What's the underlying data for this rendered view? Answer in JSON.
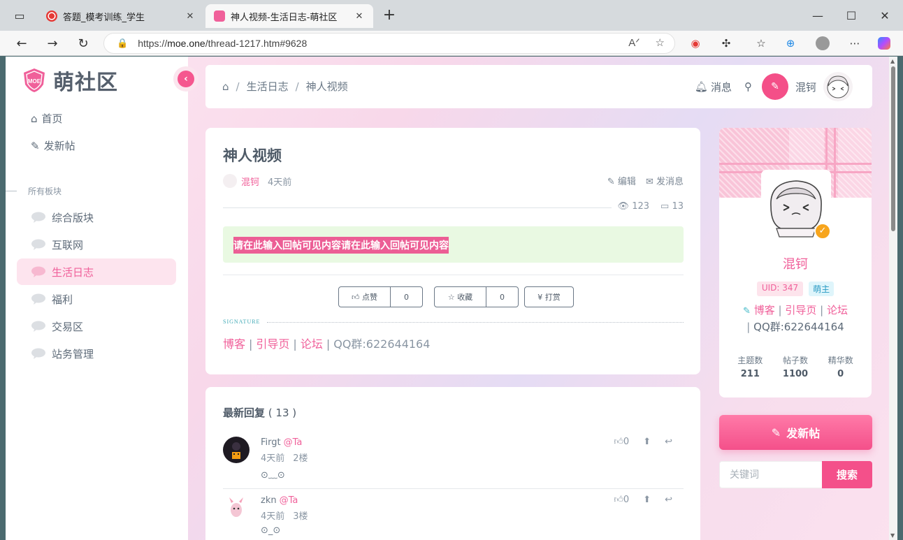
{
  "browser": {
    "tabs": [
      {
        "label": "答题_模考训练_学生"
      },
      {
        "label": "神人视频-生活日志-萌社区"
      }
    ],
    "url_prefix": "https://",
    "url_host": "moe.one",
    "url_path": "/thread-1217.htm#9628"
  },
  "sidebar": {
    "brand": "萌社区",
    "logo_text": "MOE",
    "nav": [
      {
        "label": "首页"
      },
      {
        "label": "发新帖"
      }
    ],
    "section_label": "所有板块",
    "forums": [
      {
        "label": "综合版块"
      },
      {
        "label": "互联网"
      },
      {
        "label": "生活日志"
      },
      {
        "label": "福利"
      },
      {
        "label": "交易区"
      },
      {
        "label": "站务管理"
      }
    ]
  },
  "header": {
    "breadcrumb": [
      "生活日志",
      "神人视频"
    ],
    "messages": "消息",
    "username": "混钶"
  },
  "thread": {
    "title": "神人视频",
    "author": "混钶",
    "time": "4天前",
    "edit": "编辑",
    "send_message": "发消息",
    "views": "123",
    "comments": "13",
    "hidden_text": "请在此输入回帖可见内容请在此输入回帖可见内容",
    "like_label": "点赞",
    "like_count": "0",
    "fav_label": "收藏",
    "fav_count": "0",
    "tip_label": "¥ 打赏",
    "signature_label": "SIGNATURE",
    "signature": {
      "blog": "博客",
      "guide": "引导页",
      "forum": "论坛",
      "qq": "QQ群:622644164"
    }
  },
  "replies": {
    "title": "最新回复",
    "count": "( 13 )",
    "items": [
      {
        "name": "Firgt",
        "at": "@Ta",
        "time": "4天前",
        "floor": "2楼",
        "body": "⊙﹏⊙",
        "likes": "0"
      },
      {
        "name": "zkn",
        "at": "@Ta",
        "time": "4天前",
        "floor": "3楼",
        "body": "⊙_⊙",
        "likes": "0"
      }
    ]
  },
  "profile": {
    "name": "混钶",
    "uid": "UID: 347",
    "role": "萌主",
    "links": {
      "blog": "博客",
      "guide": "引导页",
      "forum": "论坛",
      "qq": "QQ群:622644164"
    },
    "stats": [
      {
        "label": "主题数",
        "value": "211"
      },
      {
        "label": "帖子数",
        "value": "1100"
      },
      {
        "label": "精华数",
        "value": "0"
      }
    ]
  },
  "new_post_button": "发新帖",
  "search": {
    "placeholder": "关键词",
    "button": "搜索"
  },
  "colors": {
    "accent": "#f4508a",
    "hidden_bg": "#e9f9e2",
    "role_badge": "#2b9bc4"
  }
}
